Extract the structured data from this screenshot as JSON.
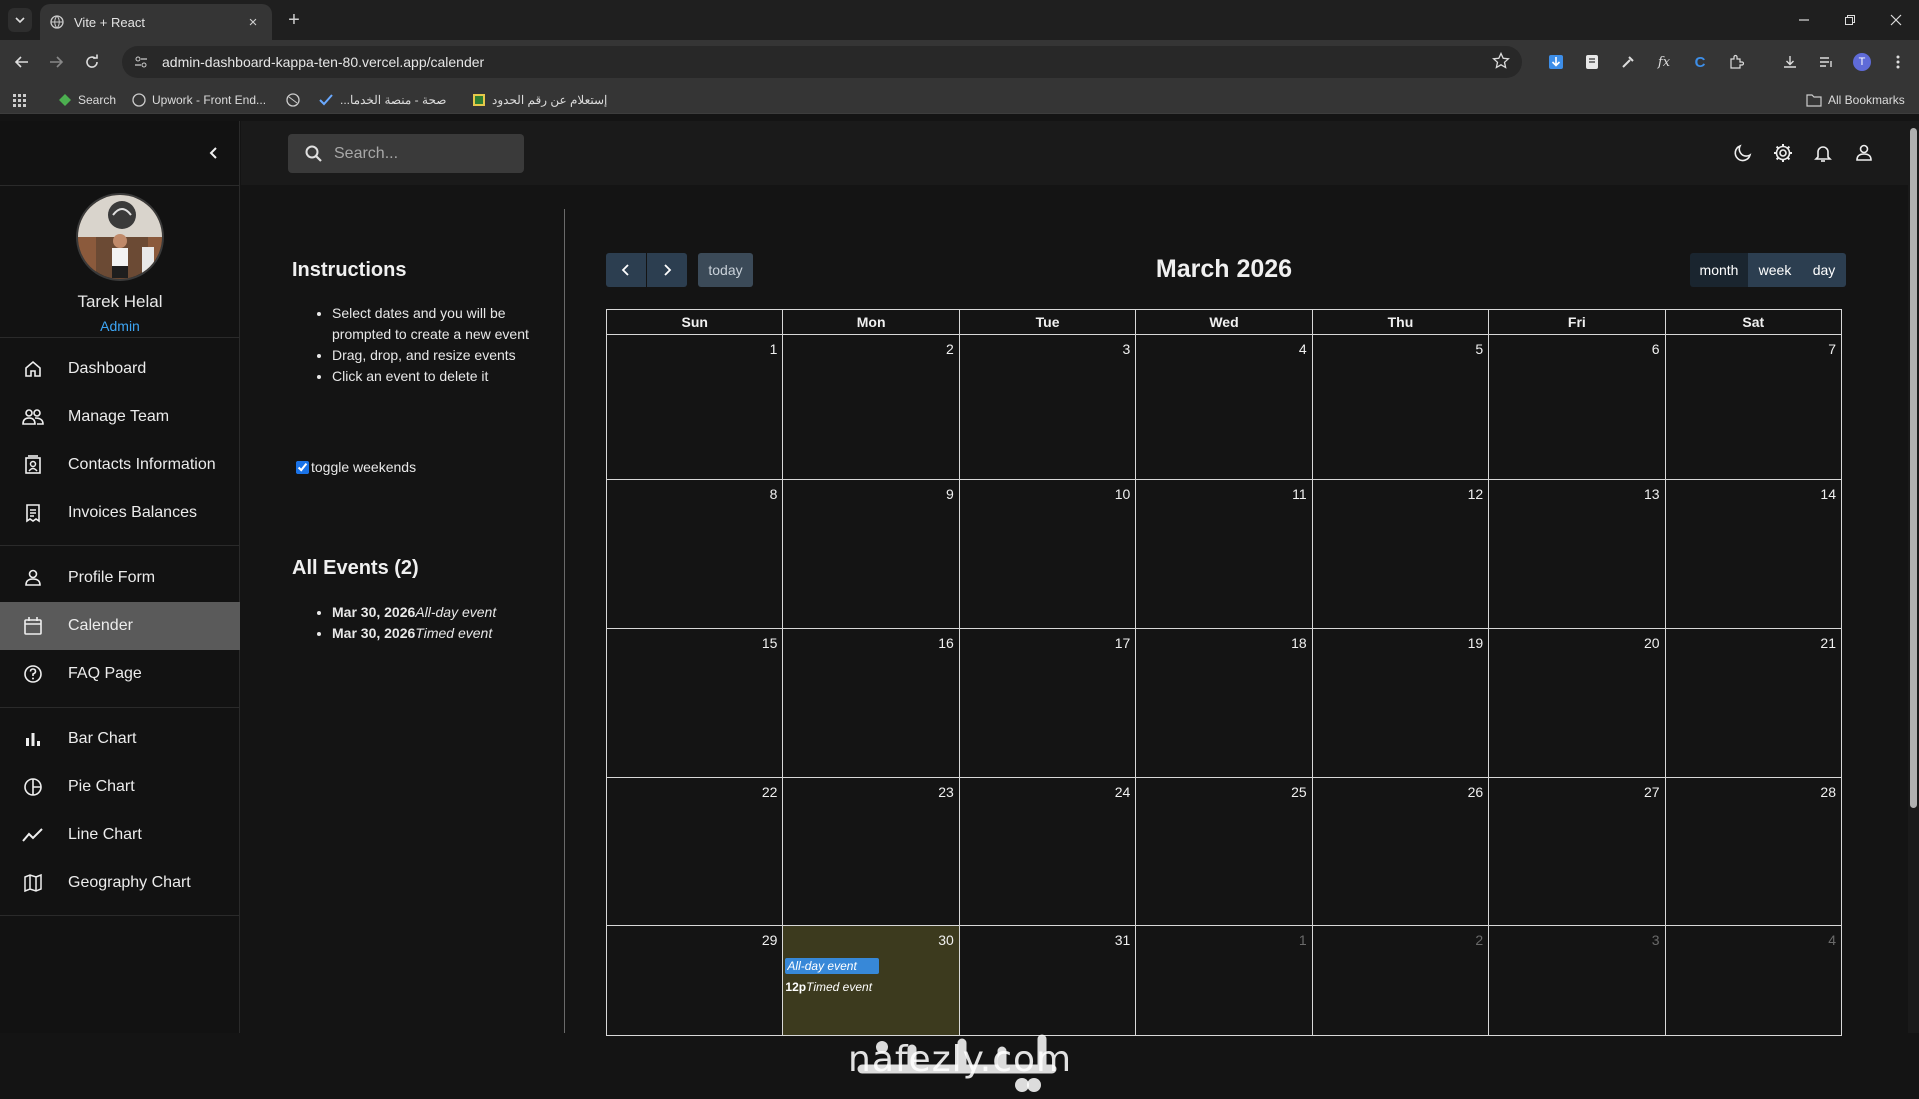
{
  "browser": {
    "tab_title": "Vite + React",
    "url": "admin-dashboard-kappa-ten-80.vercel.app/calender",
    "bookmarks": [
      "Search",
      "Upwork - Front End...",
      "صحة - منصة الخدما...",
      "إستعلام عن رقم الحدود",
      "All Bookmarks"
    ],
    "profile_initial": "T"
  },
  "sidebar": {
    "user_name": "Tarek Helal",
    "user_role": "Admin",
    "items": [
      {
        "label": "Dashboard",
        "icon": "home-icon"
      },
      {
        "label": "Manage Team",
        "icon": "team-icon"
      },
      {
        "label": "Contacts Information",
        "icon": "contacts-icon"
      },
      {
        "label": "Invoices Balances",
        "icon": "invoice-icon"
      },
      {
        "label": "Profile Form",
        "icon": "person-icon"
      },
      {
        "label": "Calender",
        "icon": "calendar-icon",
        "active": true
      },
      {
        "label": "FAQ Page",
        "icon": "help-icon"
      },
      {
        "label": "Bar Chart",
        "icon": "bar-chart-icon"
      },
      {
        "label": "Pie Chart",
        "icon": "pie-chart-icon"
      },
      {
        "label": "Line Chart",
        "icon": "line-chart-icon"
      },
      {
        "label": "Geography Chart",
        "icon": "map-icon"
      }
    ]
  },
  "topbar": {
    "search_placeholder": "Search..."
  },
  "instructions": {
    "title": "Instructions",
    "items": [
      "Select dates and you will be prompted to create a new event",
      "Drag, drop, and resize events",
      "Click an event to delete it"
    ],
    "toggle_label": "toggle weekends"
  },
  "events_panel": {
    "title": "All Events (2)",
    "events": [
      {
        "date": "Mar 30, 2026",
        "title": "All-day event"
      },
      {
        "date": "Mar 30, 2026",
        "title": "Timed event"
      }
    ]
  },
  "calendar": {
    "title": "March 2026",
    "today_label": "today",
    "views": [
      "month",
      "week",
      "day"
    ],
    "active_view": "month",
    "weekdays": [
      "Sun",
      "Mon",
      "Tue",
      "Wed",
      "Thu",
      "Fri",
      "Sat"
    ],
    "weeks": [
      [
        "1",
        "2",
        "3",
        "4",
        "5",
        "6",
        "7"
      ],
      [
        "8",
        "9",
        "10",
        "11",
        "12",
        "13",
        "14"
      ],
      [
        "15",
        "16",
        "17",
        "18",
        "19",
        "20",
        "21"
      ],
      [
        "22",
        "23",
        "24",
        "25",
        "26",
        "27",
        "28"
      ],
      [
        "29",
        "30",
        "31",
        "1",
        "2",
        "3",
        "4"
      ]
    ],
    "cell_events": {
      "allday": "All-day event",
      "timed_time": "12p",
      "timed_title": "Timed event"
    }
  },
  "watermark": "nafezly.com",
  "colors": {
    "accent": "#3da5f4",
    "button": "#2c3e50",
    "event": "#3788d8",
    "today_bg": "#3c3a1e"
  }
}
